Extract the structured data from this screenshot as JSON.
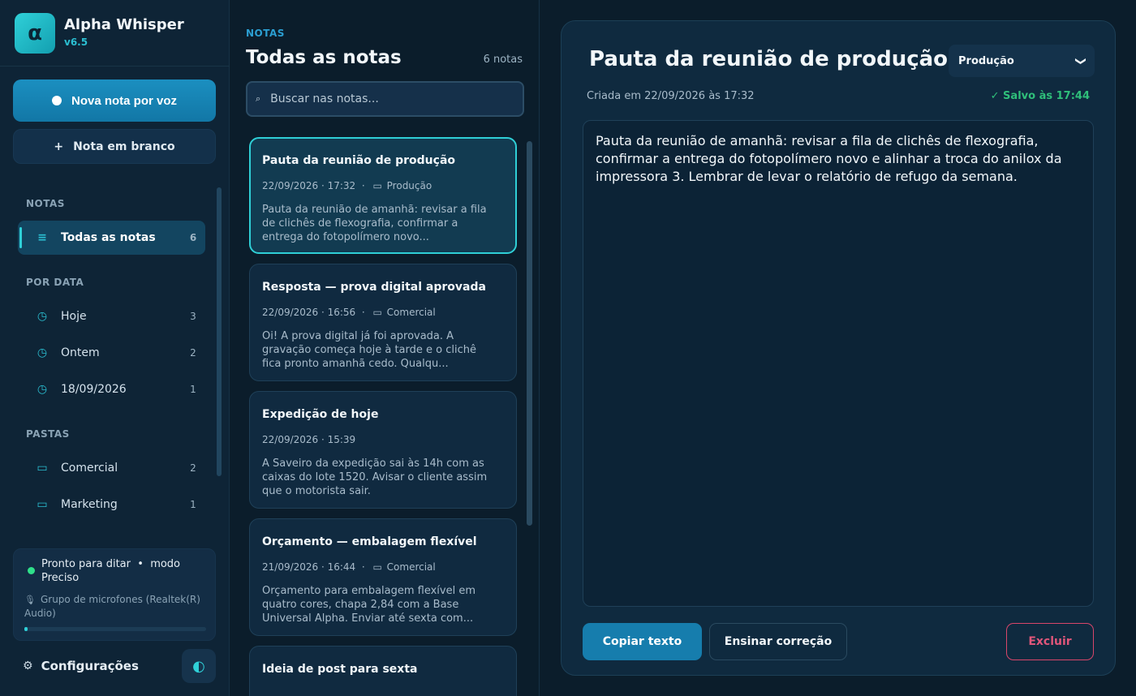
{
  "app": {
    "logo_glyph": "α",
    "name": "Alpha Whisper",
    "version": "v6.5"
  },
  "sidebar": {
    "voice_button": "Nova nota por voz",
    "blank_button_icon": "+",
    "blank_button": "Nota em branco",
    "sections": {
      "notes": "NOTAS",
      "by_date": "POR DATA",
      "folders": "PASTAS"
    },
    "notes_items": [
      {
        "icon": "≡",
        "label": "Todas as notas",
        "count": "6",
        "active": true
      }
    ],
    "date_items": [
      {
        "icon": "◷",
        "label": "Hoje",
        "count": "3"
      },
      {
        "icon": "◷",
        "label": "Ontem",
        "count": "2"
      },
      {
        "icon": "◷",
        "label": "18/09/2026",
        "count": "1"
      }
    ],
    "folder_items": [
      {
        "icon": "▭",
        "label": "Comercial",
        "count": "2"
      },
      {
        "icon": "▭",
        "label": "Marketing",
        "count": "1"
      }
    ],
    "status": {
      "text_main": "Pronto para ditar",
      "separator": "•",
      "text_mode": "modo Preciso",
      "mic_icon": "🎙",
      "mic": "Grupo de microfones (Realtek(R) Audio)",
      "level": 0.02,
      "color": "#2fe08a"
    },
    "settings_icon": "⚙",
    "settings": "Configurações",
    "theme_icon": "◐"
  },
  "list": {
    "kicker": "NOTAS",
    "title": "Todas as notas",
    "count": "6 notas",
    "search_icon": "⌕",
    "search_placeholder": "Buscar nas notas...",
    "notes": [
      {
        "title": "Pauta da reunião de produção",
        "date": "22/09/2026 · 17:32",
        "folder": "Produção",
        "excerpt": "Pauta da reunião de amanhã: revisar a fila de clichês de flexografia, confirmar a entrega do fotopolímero novo...",
        "active": true
      },
      {
        "title": "Resposta — prova digital aprovada",
        "date": "22/09/2026 · 16:56",
        "folder": "Comercial",
        "excerpt": "Oi! A prova digital já foi aprovada. A gravação começa hoje à tarde e o clichê fica pronto amanhã cedo. Qualqu..."
      },
      {
        "title": "Expedição de hoje",
        "date": "22/09/2026 · 15:39",
        "folder": "",
        "excerpt": "A Saveiro da expedição sai às 14h com as caixas do lote 1520. Avisar o cliente assim que o motorista sair."
      },
      {
        "title": "Orçamento — embalagem flexível",
        "date": "21/09/2026 · 16:44",
        "folder": "Comercial",
        "excerpt": "Orçamento para embalagem flexível em quatro cores, chapa 2,84 com a Base Universal Alpha. Enviar até sexta com..."
      },
      {
        "title": "Ideia de post para sexta",
        "date": "",
        "folder": "",
        "excerpt": ""
      }
    ]
  },
  "editor": {
    "title": "Pauta da reunião de produção",
    "folder_selected": "Produção",
    "folder_chevron": "❯",
    "created": "Criada em 22/09/2026 às 17:32",
    "saved": "✓ Salvo às 17:44",
    "body": "Pauta da reunião de amanhã: revisar a fila de clichês de flexografia, confirmar a entrega do fotopolímero novo e alinhar a troca do anilox da impressora 3. Lembrar de levar o relatório de refugo da semana.",
    "copy_button": "Copiar texto",
    "teach_button": "Ensinar correção",
    "delete_button": "Excluir"
  },
  "colors": {
    "accent": "#2fd0d8",
    "primary": "#167dad",
    "success": "#2fbf7a",
    "danger": "#e0567a"
  }
}
